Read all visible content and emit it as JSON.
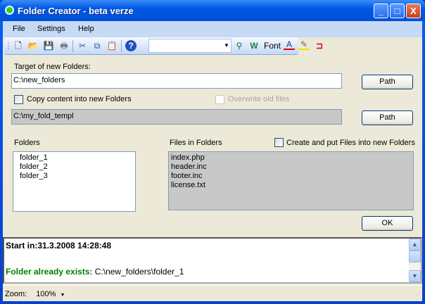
{
  "window": {
    "title": "Folder Creator - beta verze",
    "minimize": "_",
    "maximize": "□",
    "close": "X"
  },
  "menu": [
    "File",
    "Settings",
    "Help"
  ],
  "toolbar": {
    "font_label": "Font",
    "combo_value": ""
  },
  "target": {
    "label": "Target of new Folders:",
    "value": "C:\\new_folders",
    "path_button": "Path"
  },
  "copy": {
    "label": "Copy content into new Folders",
    "checked": false,
    "overwrite_label": "Overwrite old files",
    "template_value": "C:\\my_fold_templ",
    "path_button": "Path"
  },
  "folders": {
    "label": "Folders",
    "items": [
      "folder_1",
      "folder_2",
      "folder_3"
    ]
  },
  "files": {
    "label": "Files in Folders",
    "create_label": "Create and put Files into new Folders",
    "items": [
      "index.php",
      "header.inc",
      "footer.inc",
      "license.txt"
    ]
  },
  "ok_button": "OK",
  "log": {
    "start": "Start in:31.3.2008 14:28:48",
    "exists_label": "Folder already exists:",
    "exists_path": "C:\\new_folders\\folder_1",
    "colors": {
      "exists": "#008000"
    }
  },
  "status": {
    "zoom_label": "Zoom:",
    "zoom_value": "100%"
  }
}
